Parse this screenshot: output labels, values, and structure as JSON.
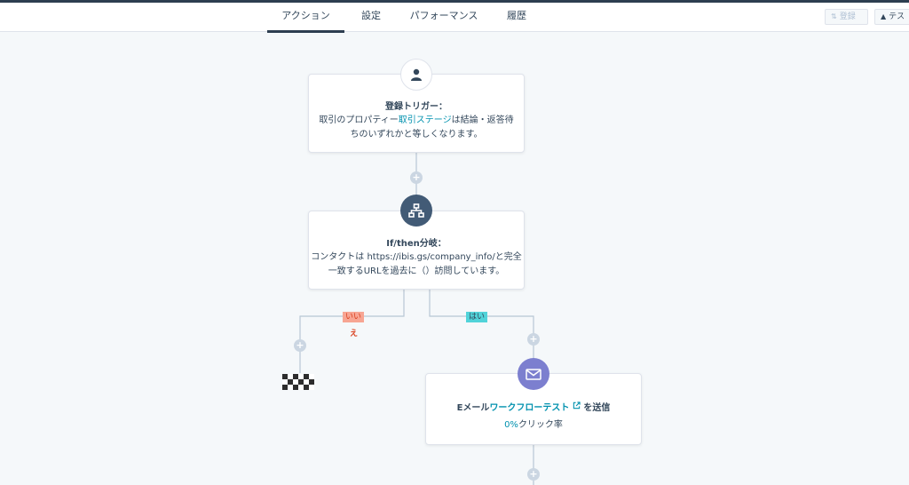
{
  "tabs": [
    {
      "label": "アクション"
    },
    {
      "label": "設定"
    },
    {
      "label": "パフォーマンス"
    },
    {
      "label": "履歴"
    }
  ],
  "toolbar": {
    "enroll_label": "登録",
    "test_label": "テス"
  },
  "trigger": {
    "title": "登録トリガー：",
    "text_1": "取引のプロパティー",
    "link": "取引ステージ",
    "text_2": "は結論・返答待",
    "text_3": "ちのいずれかと等しくなります。"
  },
  "branch": {
    "title": "If/then分岐：",
    "line_1": "コンタクトは https://ibis.gs/company_info/と完全",
    "line_2": "一致するURLを過去に（）訪問しています。"
  },
  "branch_labels": {
    "no_1": "いい",
    "no_2": "え",
    "yes": "はい"
  },
  "email_action": {
    "prefix": "Eメール",
    "link": "ワークフローテスト",
    "suffix": "を送信",
    "rate": "0%",
    "rate_label": "クリック率"
  },
  "icons": {
    "trigger": "user-icon",
    "branch": "branch-icon",
    "email": "envelope-icon",
    "external": "external-link-icon"
  },
  "colors": {
    "accent_dark": "#425b76",
    "email_purple": "#7c7fcf",
    "link": "#0091ae",
    "no_tag_bg": "#f7a593",
    "no_tag_text": "#d9401e",
    "yes_tag_bg": "#51d3d9"
  }
}
